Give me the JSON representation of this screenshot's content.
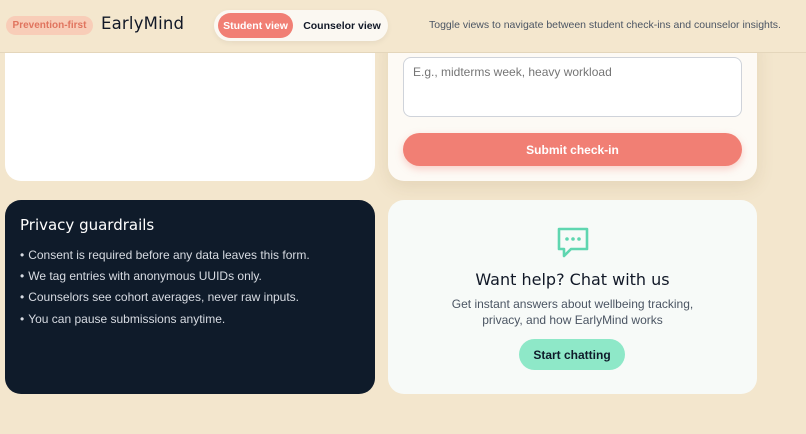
{
  "header": {
    "badge": "Prevention-first",
    "brand": "EarlyMind",
    "toggle": {
      "student": "Student view",
      "counselor": "Counselor view",
      "selected": "Student view"
    },
    "hint": "Toggle views to navigate between student check-ins and counselor insights."
  },
  "checkin": {
    "placeholder": "E.g., midterms week, heavy workload",
    "submit_label": "Submit check-in"
  },
  "privacy": {
    "title": "Privacy guardrails",
    "items": [
      "Consent is required before any data leaves this form.",
      "We tag entries with anonymous UUIDs only.",
      "Counselors see cohort averages, never raw inputs.",
      "You can pause submissions anytime."
    ]
  },
  "help": {
    "icon": "chat-bubble-icon",
    "title": "Want help? Chat with us",
    "description": "Get instant answers about wellbeing tracking, privacy, and how EarlyMind works",
    "button_label": "Start chatting"
  },
  "colors": {
    "background": "#f3e6cd",
    "accent_coral": "#f17f74",
    "accent_mint": "#8ee8c8",
    "dark_navy": "#0f1b2a",
    "chat_icon": "#5fd6b0"
  }
}
